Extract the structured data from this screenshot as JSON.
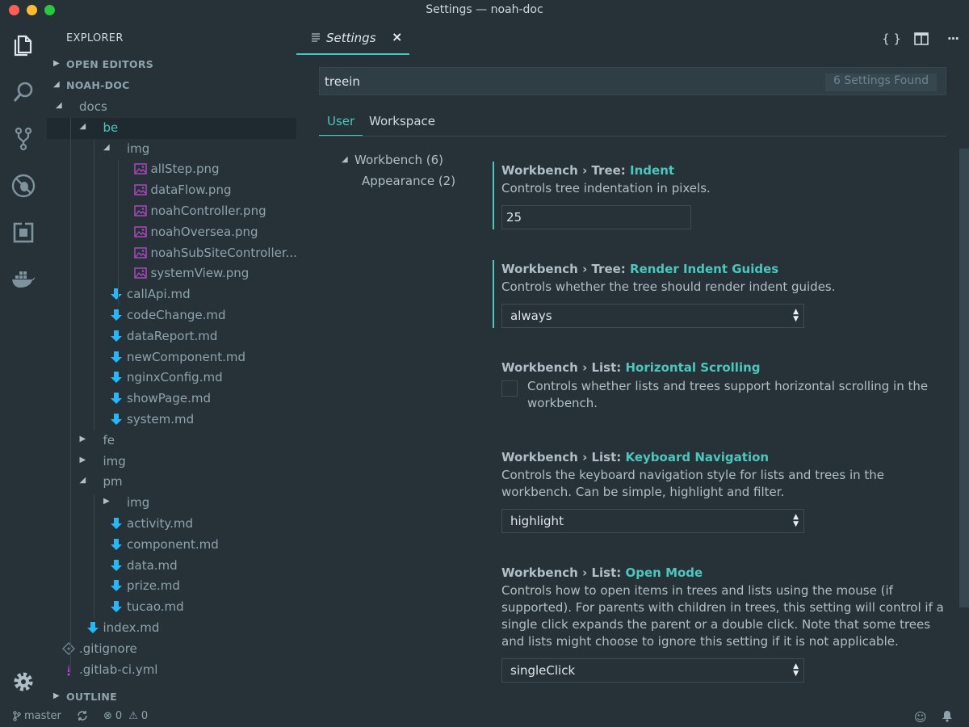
{
  "window": {
    "title": "Settings — noah-doc"
  },
  "activity": {
    "items": [
      {
        "name": "files-icon"
      },
      {
        "name": "search-icon"
      },
      {
        "name": "source-control-icon"
      },
      {
        "name": "debug-icon"
      },
      {
        "name": "extensions-icon"
      },
      {
        "name": "docker-icon"
      }
    ],
    "settings_icon": "gear-icon"
  },
  "sidebar": {
    "header": "EXPLORER",
    "open_editors": "OPEN EDITORS",
    "project": "NOAH-DOC",
    "outline": "OUTLINE",
    "tree": [
      {
        "label": "docs",
        "depth": 0,
        "kind": "folder",
        "open": true
      },
      {
        "label": "be",
        "depth": 1,
        "kind": "folder",
        "open": true,
        "selected": true
      },
      {
        "label": "img",
        "depth": 2,
        "kind": "folder",
        "open": true
      },
      {
        "label": "allStep.png",
        "depth": 3,
        "kind": "image"
      },
      {
        "label": "dataFlow.png",
        "depth": 3,
        "kind": "image"
      },
      {
        "label": "noahController.png",
        "depth": 3,
        "kind": "image"
      },
      {
        "label": "noahOversea.png",
        "depth": 3,
        "kind": "image"
      },
      {
        "label": "noahSubSiteController....",
        "depth": 3,
        "kind": "image"
      },
      {
        "label": "systemView.png",
        "depth": 3,
        "kind": "image"
      },
      {
        "label": "callApi.md",
        "depth": 2,
        "kind": "md"
      },
      {
        "label": "codeChange.md",
        "depth": 2,
        "kind": "md"
      },
      {
        "label": "dataReport.md",
        "depth": 2,
        "kind": "md"
      },
      {
        "label": "newComponent.md",
        "depth": 2,
        "kind": "md"
      },
      {
        "label": "nginxConfig.md",
        "depth": 2,
        "kind": "md"
      },
      {
        "label": "showPage.md",
        "depth": 2,
        "kind": "md"
      },
      {
        "label": "system.md",
        "depth": 2,
        "kind": "md"
      },
      {
        "label": "fe",
        "depth": 1,
        "kind": "folder",
        "open": false
      },
      {
        "label": "img",
        "depth": 1,
        "kind": "folder",
        "open": false
      },
      {
        "label": "pm",
        "depth": 1,
        "kind": "folder",
        "open": true
      },
      {
        "label": "img",
        "depth": 2,
        "kind": "folder",
        "open": false
      },
      {
        "label": "activity.md",
        "depth": 2,
        "kind": "md"
      },
      {
        "label": "component.md",
        "depth": 2,
        "kind": "md"
      },
      {
        "label": "data.md",
        "depth": 2,
        "kind": "md"
      },
      {
        "label": "prize.md",
        "depth": 2,
        "kind": "md"
      },
      {
        "label": "tucao.md",
        "depth": 2,
        "kind": "md"
      },
      {
        "label": "index.md",
        "depth": 1,
        "kind": "md"
      },
      {
        "label": ".gitignore",
        "depth": 0,
        "kind": "git"
      },
      {
        "label": ".gitlab-ci.yml",
        "depth": 0,
        "kind": "yml"
      }
    ]
  },
  "editor": {
    "tab": {
      "label": "Settings",
      "close": "×"
    },
    "actions": {
      "json": "{ }",
      "split": "split-icon",
      "more": "···"
    },
    "search": {
      "value": "treein",
      "found": "6 Settings Found"
    },
    "scopes": {
      "user": "User",
      "workspace": "Workspace"
    },
    "toc": {
      "group": "Workbench (6)",
      "child": "Appearance (2)"
    },
    "settings": [
      {
        "category": "Workbench › Tree: ",
        "key": "Indent",
        "desc": "Controls tree indentation in pixels.",
        "control": "input",
        "value": "25",
        "modified": true
      },
      {
        "category": "Workbench › Tree: ",
        "key": "Render Indent Guides",
        "desc": "Controls whether the tree should render indent guides.",
        "control": "select",
        "value": "always",
        "modified": true
      },
      {
        "category": "Workbench › List: ",
        "key": "Horizontal Scrolling",
        "desc": "Controls whether lists and trees support horizontal scrolling in the workbench.",
        "control": "checkbox",
        "checked": false,
        "modified": false
      },
      {
        "category": "Workbench › List: ",
        "key": "Keyboard Navigation",
        "desc": "Controls the keyboard navigation style for lists and trees in the workbench. Can be simple, highlight and filter.",
        "control": "select",
        "value": "highlight",
        "modified": false
      },
      {
        "category": "Workbench › List: ",
        "key": "Open Mode",
        "desc": "Controls how to open items in trees and lists using the mouse (if supported). For parents with children in trees, this setting will control if a single click expands the parent or a double click. Note that some trees and lists might choose to ignore this setting if it is not applicable.",
        "control": "select",
        "value": "singleClick",
        "modified": false
      }
    ]
  },
  "status": {
    "branch": "master",
    "errors": "0",
    "warnings": "0"
  },
  "colors": {
    "accent": "#4dc6bd",
    "background": "#263238",
    "md_icon": "#29b6f6",
    "image_icon": "#ab47bc",
    "yml_icon": "#e040fb"
  }
}
